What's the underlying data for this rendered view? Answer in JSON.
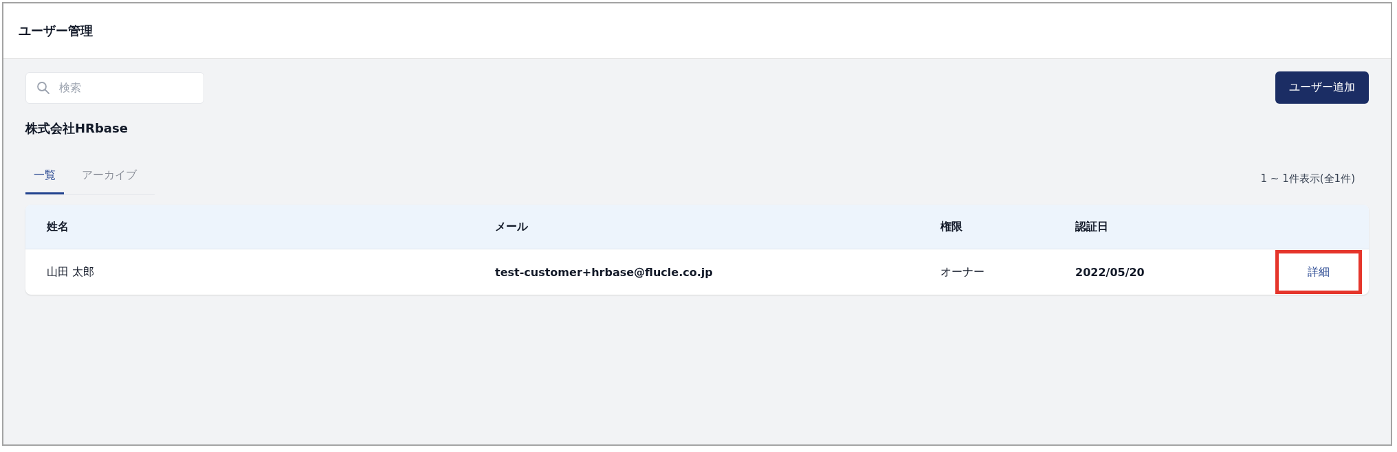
{
  "header": {
    "title": "ユーザー管理"
  },
  "search": {
    "placeholder": "検索"
  },
  "add_button": "ユーザー追加",
  "company": "株式会社HRbase",
  "tabs": [
    {
      "label": "一覧",
      "selected": true
    },
    {
      "label": "アーカイブ",
      "selected": false
    }
  ],
  "count": "1 ~ 1件表示(全1件)",
  "table": {
    "columns": [
      "姓名",
      "メール",
      "権限",
      "認証日"
    ],
    "rows": [
      {
        "name": "山田 太郎",
        "email": "test-customer+hrbase@flucle.co.jp",
        "role": "オーナー",
        "date": "2022/05/20",
        "action": "詳細",
        "highlighted": true
      }
    ]
  }
}
